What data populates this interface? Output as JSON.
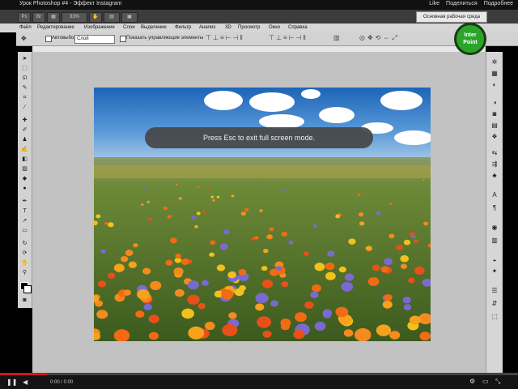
{
  "youtube_bar": {
    "title": "Урок Photoshop #4 - Эффект Instagram",
    "like": "Like",
    "share": "Поделиться",
    "more": "Подробнее"
  },
  "app_bar": {
    "zoom": "33%",
    "workspace": "Основная рабочая среда"
  },
  "menu": [
    "Файл",
    "Редактирование",
    "Изображение",
    "Слои",
    "Выделение",
    "Фильтр",
    "Анализ",
    "3D",
    "Просмотр",
    "Окно",
    "Справка"
  ],
  "options_bar": {
    "autoselect_label": "Автовыбор:",
    "autoselect_value": "Слой",
    "show_controls_label": "Показать управляющие элементы"
  },
  "toast": {
    "message": "Press Esc to exit full screen mode."
  },
  "logo": {
    "line1": "Inter",
    "line2": "Point"
  },
  "player": {
    "time": "0:00 / 0:00",
    "progress": 0.09
  },
  "colors": {
    "toast_bg": "#464648",
    "progress_red": "#cc181e",
    "logo_green": "#2aa52a"
  },
  "icons": {
    "toolbox": [
      "move-tool-icon",
      "marquee-tool-icon",
      "lasso-tool-icon",
      "quick-select-icon",
      "crop-tool-icon",
      "eyedropper-icon",
      "healing-brush-icon",
      "brush-tool-icon",
      "clone-stamp-icon",
      "history-brush-icon",
      "eraser-icon",
      "gradient-icon",
      "blur-icon",
      "dodge-icon",
      "pen-tool-icon",
      "type-tool-icon",
      "path-select-icon",
      "shape-tool-icon",
      "3d-rotate-icon",
      "3d-orbit-icon",
      "hand-tool-icon",
      "zoom-tool-icon"
    ],
    "right_panel": [
      "color-panel-icon",
      "swatches-icon",
      "styles-icon",
      "adjustments-icon",
      "masks-icon",
      "layers-icon",
      "channels-icon",
      "paths-icon",
      "character-icon",
      "paragraph-icon",
      "history-icon",
      "actions-icon",
      "brushes-icon",
      "clone-source-icon"
    ]
  }
}
